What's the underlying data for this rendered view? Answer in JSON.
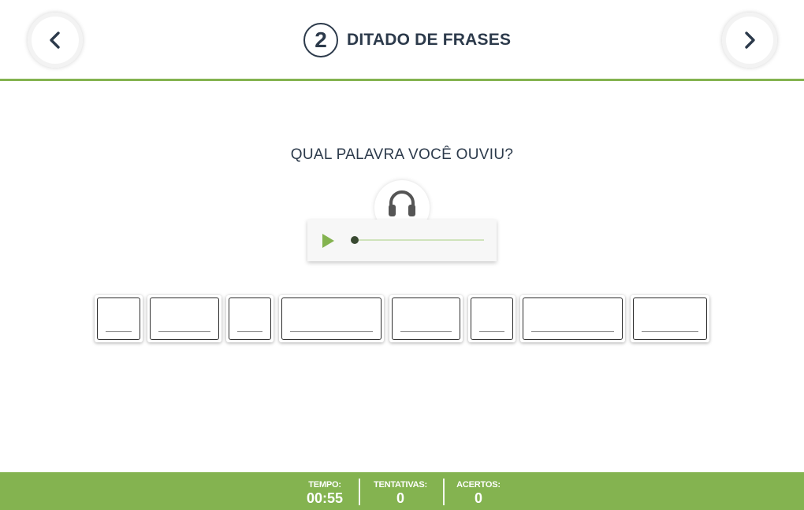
{
  "header": {
    "step_number": "2",
    "title": "DITADO DE FRASES",
    "prev_icon": "chevron-left-icon",
    "next_icon": "chevron-right-icon"
  },
  "exercise": {
    "question": "QUAL PALAVRA VOCÊ OUVIU?",
    "headphones_icon": "headphones-icon",
    "player": {
      "play_icon": "play-icon",
      "progress": 0
    },
    "answer_boxes": [
      {
        "value": ""
      },
      {
        "value": ""
      },
      {
        "value": ""
      },
      {
        "value": ""
      },
      {
        "value": ""
      },
      {
        "value": ""
      },
      {
        "value": ""
      },
      {
        "value": ""
      }
    ]
  },
  "footer": {
    "time_label": "TEMPO:",
    "time_value": "00:55",
    "attempts_label": "TENTATIVAS:",
    "attempts_value": "0",
    "hits_label": "ACERTOS:",
    "hits_value": "0"
  },
  "colors": {
    "accent": "#84b350",
    "text": "#2c3a4b"
  }
}
